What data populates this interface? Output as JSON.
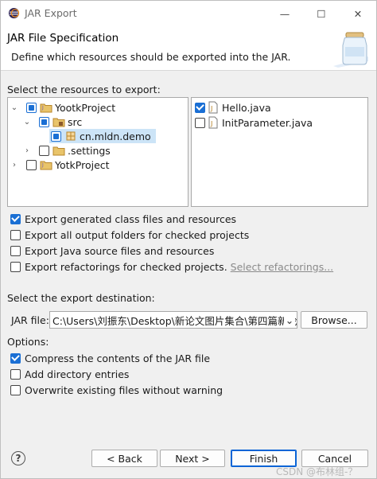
{
  "window": {
    "title": "JAR Export",
    "minimize_glyph": "—",
    "maximize_glyph": "☐",
    "close_glyph": "✕"
  },
  "header": {
    "title": "JAR File Specification",
    "description": "Define which resources should be exported into the JAR."
  },
  "resources": {
    "label": "Select the resources to export:",
    "tree": [
      {
        "label": "YootkProject",
        "state": "partial",
        "expanded": true,
        "icon": "project-icon"
      },
      {
        "label": "src",
        "state": "partial",
        "expanded": true,
        "icon": "source-folder-icon"
      },
      {
        "label": "cn.mldn.demo",
        "state": "partial",
        "selected": true,
        "icon": "package-icon"
      },
      {
        "label": ".settings",
        "state": "unchecked",
        "expanded": false,
        "icon": "folder-icon"
      },
      {
        "label": "YotkProject",
        "state": "unchecked",
        "expanded": false,
        "icon": "project-icon"
      }
    ],
    "files": [
      {
        "label": "Hello.java",
        "checked": true,
        "icon": "java-file-icon"
      },
      {
        "label": "InitParameter.java",
        "checked": false,
        "icon": "java-file-icon"
      }
    ]
  },
  "options_top": [
    {
      "label": "Export generated class files and resources",
      "checked": true
    },
    {
      "label": "Export all output folders for checked projects",
      "checked": false
    },
    {
      "label": "Export Java source files and resources",
      "checked": false
    },
    {
      "label": "Export refactorings for checked projects.",
      "checked": false,
      "link": "Select refactorings..."
    }
  ],
  "destination": {
    "label": "Select the export destination:",
    "jar_file_label": "JAR file:",
    "jar_file_value": "C:\\Users\\刘振东\\Desktop\\新论文图片集合\\第四篇新论",
    "browse_label": "Browse..."
  },
  "options": {
    "label": "Options:",
    "items": [
      {
        "label": "Compress the contents of the JAR file",
        "checked": true
      },
      {
        "label": "Add directory entries",
        "checked": false
      },
      {
        "label": "Overwrite existing files without warning",
        "checked": false
      }
    ]
  },
  "footer": {
    "help_glyph": "?",
    "back_label": "< Back",
    "next_label": "Next >",
    "finish_label": "Finish",
    "cancel_label": "Cancel",
    "watermark": "CSDN @布林组-？"
  },
  "colors": {
    "accent": "#1a6fd4",
    "selection": "#cce4f7"
  }
}
